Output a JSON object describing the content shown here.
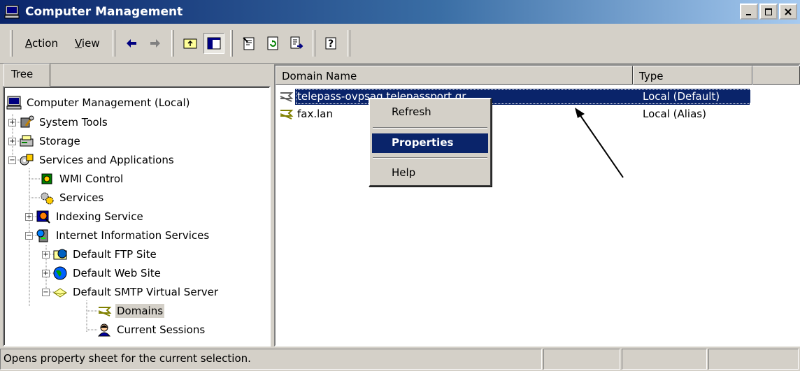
{
  "window": {
    "title": "Computer Management",
    "buttons": [
      "minimize",
      "maximize",
      "close"
    ]
  },
  "toolbar": {
    "menu": [
      "Action",
      "View"
    ],
    "menu_accel": [
      "A",
      "V"
    ]
  },
  "tab": {
    "label": "Tree"
  },
  "tree": {
    "root": "Computer Management (Local)",
    "system_tools": "System Tools",
    "storage": "Storage",
    "services_apps": "Services and Applications",
    "wmi": "WMI Control",
    "services": "Services",
    "indexing": "Indexing Service",
    "iis": "Internet Information Services",
    "ftp": "Default FTP Site",
    "web": "Default Web Site",
    "smtp": "Default SMTP Virtual Server",
    "domains": "Domains",
    "sessions": "Current Sessions"
  },
  "list": {
    "columns": {
      "name": "Domain Name",
      "type": "Type"
    },
    "rows": [
      {
        "name": "telepass-ovpsag.telepassport.gr",
        "type": "Local (Default)"
      },
      {
        "name": "fax.lan",
        "type": "Local (Alias)"
      }
    ]
  },
  "context_menu": {
    "refresh": "Refresh",
    "properties": "Properties",
    "help": "Help"
  },
  "status": {
    "text": "Opens property sheet for the current selection."
  },
  "colors": {
    "title_start": "#0a246a",
    "title_end": "#a6caf0",
    "selection": "#0a246a",
    "face": "#d4d0c8"
  }
}
